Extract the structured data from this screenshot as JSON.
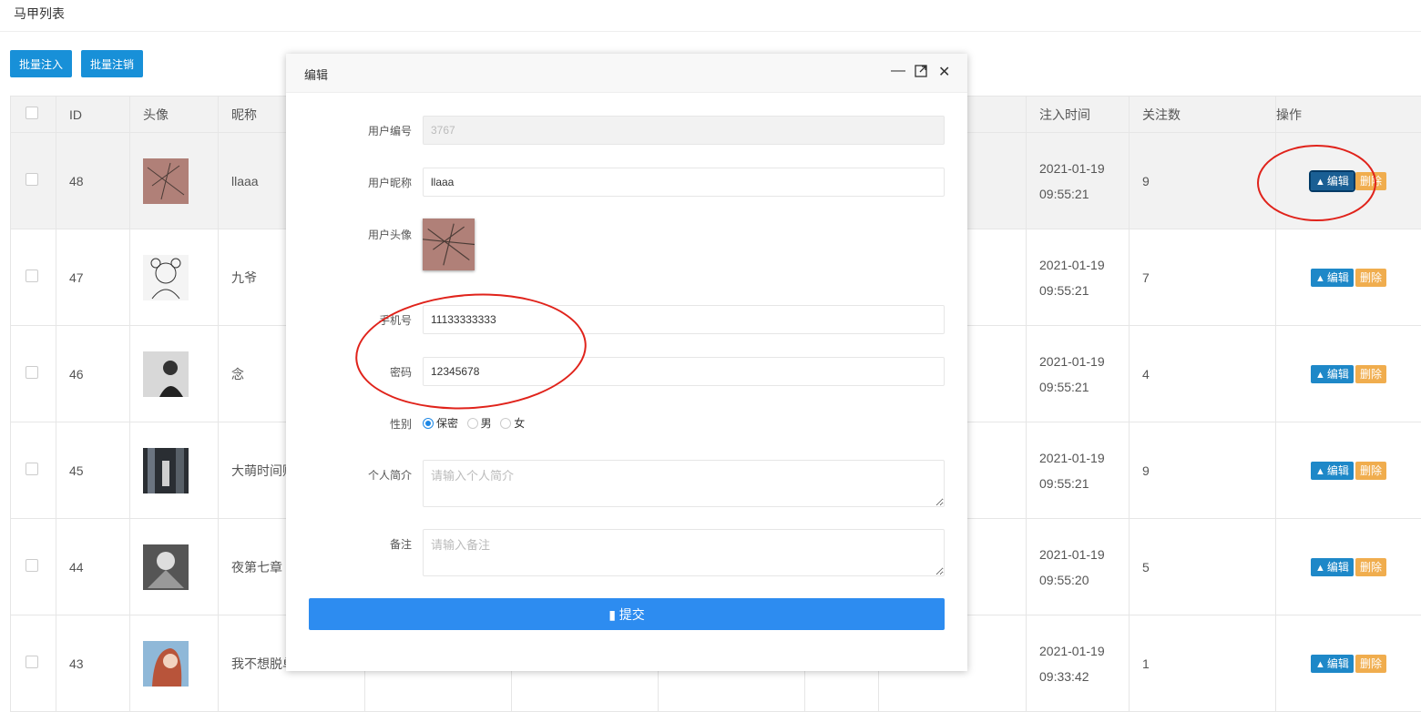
{
  "page": {
    "title": "马甲列表"
  },
  "toolbar": {
    "batch_inject": "批量注入",
    "batch_cancel": "批量注销"
  },
  "table": {
    "headers": {
      "id": "ID",
      "avatar": "头像",
      "nickname": "昵称",
      "inject_time": "注入时间",
      "follows": "关注数",
      "ops": "操作"
    },
    "edit_label": "编辑",
    "delete_label": "删除",
    "rows": [
      {
        "id": "48",
        "nickname": "llaaa",
        "date": "2021-01-19",
        "time": "09:55:21",
        "follows": "9"
      },
      {
        "id": "47",
        "nickname": "九爷",
        "date": "2021-01-19",
        "time": "09:55:21",
        "follows": "7"
      },
      {
        "id": "46",
        "nickname": "念",
        "date": "2021-01-19",
        "time": "09:55:21",
        "follows": "4"
      },
      {
        "id": "45",
        "nickname": "大萌时间贩",
        "date": "2021-01-19",
        "time": "09:55:21",
        "follows": "9"
      },
      {
        "id": "44",
        "nickname": "夜第七章",
        "date": "2021-01-19",
        "time": "09:55:20",
        "follows": "5"
      },
      {
        "id": "43",
        "nickname": "我不想脱单",
        "date": "2021-01-19",
        "time": "09:33:42",
        "follows": "1"
      }
    ]
  },
  "modal": {
    "title": "编辑",
    "fields": {
      "user_id_label": "用户编号",
      "user_id_value": "3767",
      "nickname_label": "用户昵称",
      "nickname_value": "llaaa",
      "avatar_label": "用户头像",
      "phone_label": "手机号",
      "phone_value": "11133333333",
      "password_label": "密码",
      "password_value": "12345678",
      "gender_label": "性别",
      "gender_options": [
        "保密",
        "男",
        "女"
      ],
      "gender_selected": "保密",
      "bio_label": "个人简介",
      "bio_placeholder": "请输入个人简介",
      "note_label": "备注",
      "note_placeholder": "请输入备注"
    },
    "submit_label": "提交"
  },
  "colors": {
    "primary": "#1e88c8",
    "danger_soft": "#f0ad4e",
    "submit": "#2d8cf0",
    "annotation": "#e0231b"
  }
}
